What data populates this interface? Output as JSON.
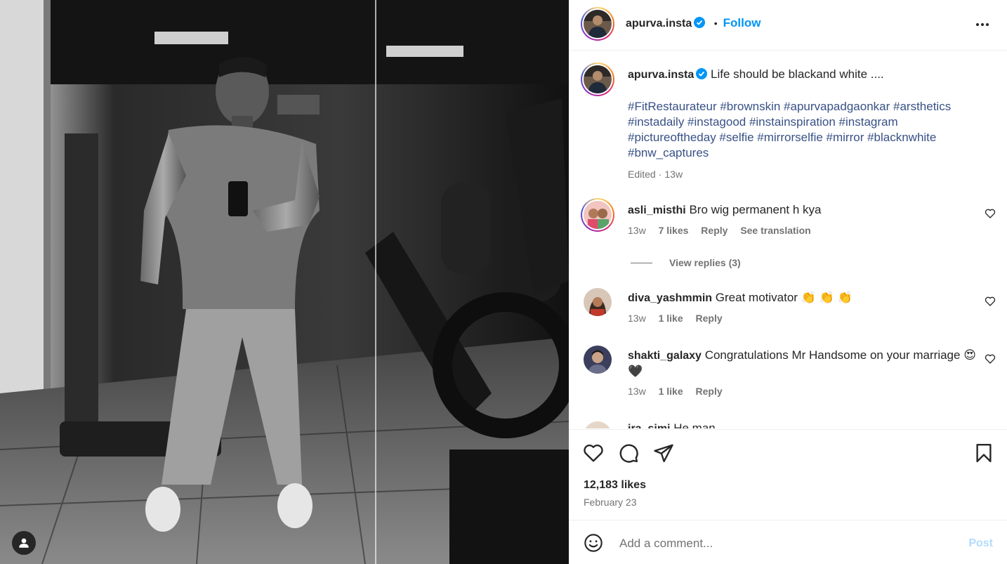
{
  "post_image": {
    "description_icon": "gym-mirror-selfie-photo",
    "user_tag_icon": "user-silhouette-icon"
  },
  "header": {
    "username": "apurva.insta",
    "separator": "•",
    "follow_label": "Follow",
    "more_icon": "more-options-icon"
  },
  "caption": {
    "username": "apurva.insta",
    "text": "Life should be blackand white ....",
    "hashtags": "#FitRestaurateur #brownskin #apurvapadgaonkar #arsthetics #instadaily #instagood #instainspiration #instagram #pictureoftheday #selfie #mirrorselfie #mirror #blacknwhite #bnw_captures",
    "edited_label": "Edited",
    "dot": "·",
    "time": "13w"
  },
  "comments": [
    {
      "username": "asli_misthi",
      "text": "Bro wig permanent h kya",
      "time": "13w",
      "likes": "7 likes",
      "reply_label": "Reply",
      "translate_label": "See translation",
      "view_replies": "View replies (3)"
    },
    {
      "username": "diva_yashmmin",
      "text": "Great motivator 👏 👏 👏",
      "time": "13w",
      "likes": "1 like",
      "reply_label": "Reply"
    },
    {
      "username": "shakti_galaxy",
      "text": "Congratulations Mr Handsome on your marriage 😍🖤",
      "time": "13w",
      "likes": "1 like",
      "reply_label": "Reply"
    },
    {
      "username": "ira_simi",
      "text": "He man"
    }
  ],
  "actions": {
    "like_icon": "heart-icon",
    "comment_icon": "comment-bubble-icon",
    "share_icon": "send-icon",
    "save_icon": "bookmark-icon",
    "likes_count": "12,183 likes",
    "date": "February 23"
  },
  "add_comment": {
    "emoji_icon": "emoji-icon",
    "placeholder": "Add a comment...",
    "post_label": "Post"
  },
  "colors": {
    "link": "#0095f6",
    "hashtag": "#385185",
    "muted": "#737373",
    "verified": "#0095f6"
  }
}
